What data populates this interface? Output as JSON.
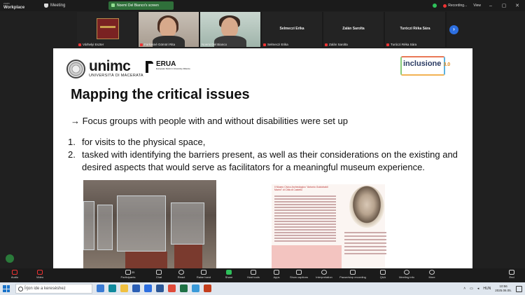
{
  "topbar": {
    "brand_small": "zoom",
    "brand": "Workplace",
    "meeting_label": "Meeting",
    "share_label": "Noemi Del Bianco's screen",
    "recording_label": "Recording...",
    "view_label": "View",
    "win_minimize": "–",
    "win_maximize": "▢",
    "win_close": "✕"
  },
  "participants": [
    {
      "name": "Várhelyi Eszter",
      "type": "image"
    },
    {
      "name": "Farkasné Gömöri Rita",
      "type": "video"
    },
    {
      "name": "Noemi Del Bianco",
      "type": "video",
      "active": true
    },
    {
      "name": "Selmeczi Erika",
      "type": "name"
    },
    {
      "name": "Zalán Sarolta",
      "type": "name"
    },
    {
      "name": "Turóczi Réka Sára",
      "type": "name"
    }
  ],
  "next_icon": "›",
  "slide": {
    "unimc_logo": "unimc",
    "unimc_sub": "UNIVERSITÀ DI MACERATA",
    "erua_logo": "ERUA",
    "erua_sub": "European Reform University Alliance",
    "inclusione_logo": "inclusione",
    "inclusione_version": "3.0",
    "title": "Mapping the critical issues",
    "arrow_text": "→ Focus groups with people with and without disabilities were set up",
    "items": [
      {
        "num": "1.",
        "text": "for visits to the physical space,"
      },
      {
        "num": "2.",
        "text": "tasked with identifying the barriers present, as well as their considerations on the existing and desired aspects that would serve as facilitators for a meaningful museum experience."
      }
    ],
    "leaflet_title": "Il Museo Civico Archeologico \"Antonio Guidobaldi Marini\" di Città di Castello"
  },
  "toolbar": {
    "audio": "Audio",
    "video": "Video",
    "participants": "Participants",
    "participants_count": "135",
    "chat": "Chat",
    "react": "React",
    "raise_hand": "Raise hand",
    "share": "Share",
    "host_tools": "Host tools",
    "apps": "Apps",
    "show_captions": "Show captions",
    "interpretation": "Interpretation",
    "pause_recording": "Pause/stop recording",
    "qa": "Q&A",
    "meeting_info": "Meeting info",
    "more": "More",
    "end": "End"
  },
  "taskbar": {
    "search_placeholder": "Írjon ide a kereséshez",
    "language": "HUN",
    "time": "10:56",
    "date": "2025.06.05."
  },
  "colors": {
    "accent_green": "#2ec05a",
    "mute_red": "#e33333",
    "nav_blue": "#2d6fe0"
  }
}
